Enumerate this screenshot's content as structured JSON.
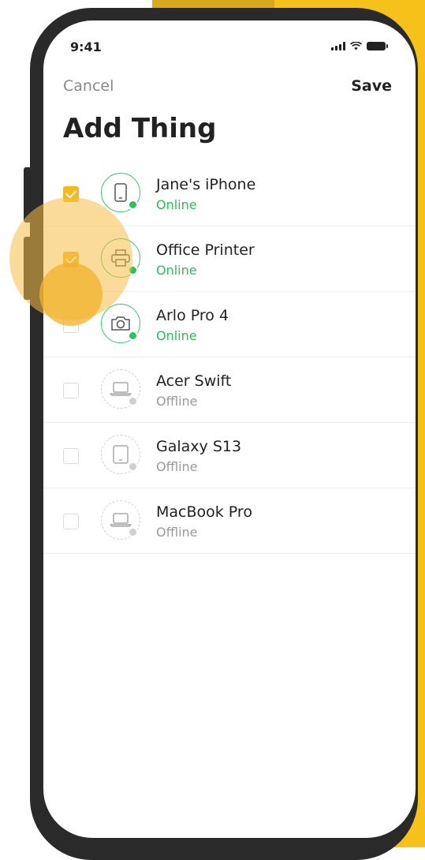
{
  "status_bar": {
    "time": "9:41"
  },
  "nav": {
    "cancel_label": "Cancel",
    "save_label": "Save"
  },
  "page": {
    "title": "Add Thing"
  },
  "devices": [
    {
      "name": "Jane's iPhone",
      "status": "Online",
      "icon": "phone-icon",
      "checked": true
    },
    {
      "name": "Office Printer",
      "status": "Online",
      "icon": "printer-icon",
      "checked": true
    },
    {
      "name": "Arlo Pro 4",
      "status": "Online",
      "icon": "camera-icon",
      "checked": false
    },
    {
      "name": "Acer Swift",
      "status": "Offline",
      "icon": "laptop-icon",
      "checked": false
    },
    {
      "name": "Galaxy S13",
      "status": "Offline",
      "icon": "tablet-icon",
      "checked": false
    },
    {
      "name": "MacBook Pro",
      "status": "Offline",
      "icon": "laptop-icon",
      "checked": false
    }
  ],
  "colors": {
    "accent": "#f6b91f",
    "online": "#2ebc5a",
    "offline": "#9a9a9a",
    "phone_frame": "#2a2a2a"
  }
}
